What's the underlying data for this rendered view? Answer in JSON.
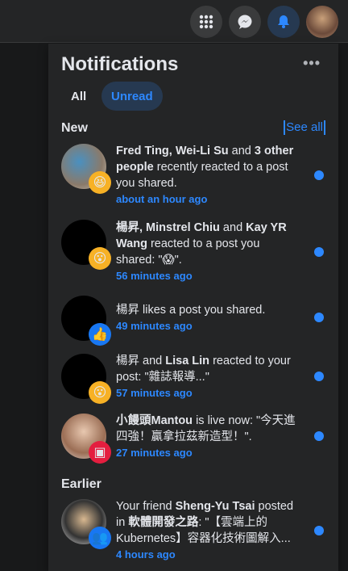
{
  "topbar": {
    "icons": [
      "menu-grid-icon",
      "messenger-icon",
      "bell-icon",
      "profile-avatar"
    ]
  },
  "panel": {
    "title": "Notifications",
    "more_label": "•••",
    "tabs": [
      {
        "label": "All",
        "active": false
      },
      {
        "label": "Unread",
        "active": true
      }
    ],
    "new_heading": "New",
    "see_all": "See all",
    "earlier_heading": "Earlier"
  },
  "notifications": [
    {
      "segments": [
        {
          "t": "Fred Ting, Wei-Li Su",
          "b": true
        },
        {
          "t": " and ",
          "b": false
        },
        {
          "t": "3 other people",
          "b": true
        },
        {
          "t": " recently reacted to a post you shared.",
          "b": false
        }
      ],
      "time": "about an hour ago",
      "badge": "😆",
      "badge_name": "haha-reaction-icon",
      "unread": true
    },
    {
      "segments": [
        {
          "t": "楊昇, Minstrel Chiu",
          "b": true
        },
        {
          "t": " and ",
          "b": false
        },
        {
          "t": "Kay YR Wang",
          "b": true
        },
        {
          "t": " reacted to a post you shared: \"😱\".",
          "b": false
        }
      ],
      "time": "56 minutes ago",
      "badge": "😮",
      "badge_name": "wow-reaction-icon",
      "unread": true
    },
    {
      "segments": [
        {
          "t": "楊昇",
          "b": false
        },
        {
          "t": " likes a post you shared.",
          "b": false
        }
      ],
      "time": "49 minutes ago",
      "badge": "👍",
      "badge_name": "like-icon",
      "unread": true
    },
    {
      "segments": [
        {
          "t": "楊昇",
          "b": false
        },
        {
          "t": " and ",
          "b": false
        },
        {
          "t": "Lisa Lin",
          "b": true
        },
        {
          "t": " reacted to your post: \"雜誌報導...\"",
          "b": false
        }
      ],
      "time": "57 minutes ago",
      "badge": "😮",
      "badge_name": "wow-reaction-icon",
      "unread": true
    },
    {
      "segments": [
        {
          "t": "小饅頭Mantou",
          "b": true
        },
        {
          "t": " is live now: \"今天進四強！贏拿拉茲新造型！\".",
          "b": false
        }
      ],
      "time": "27 minutes ago",
      "badge": "▣",
      "badge_name": "live-video-icon",
      "unread": true
    },
    {
      "segments": [
        {
          "t": "Your friend ",
          "b": false
        },
        {
          "t": "Sheng-Yu Tsai",
          "b": true
        },
        {
          "t": " posted in ",
          "b": false
        },
        {
          "t": "軟體開發之路",
          "b": true
        },
        {
          "t": ": \"【雲端上的 Kubernetes】容器化技術圖解入...",
          "b": false
        }
      ],
      "time": "4 hours ago",
      "badge": "👥",
      "badge_name": "group-icon",
      "unread": true
    }
  ]
}
